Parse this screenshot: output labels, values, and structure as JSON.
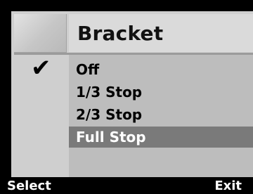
{
  "header": {
    "title": "Bracket"
  },
  "menu": {
    "checked_index": 0,
    "selected_index": 3,
    "items": [
      {
        "label": "Off"
      },
      {
        "label": "1/3 Stop"
      },
      {
        "label": "2/3 Stop"
      },
      {
        "label": "Full Stop"
      }
    ]
  },
  "softkeys": {
    "left": "Select",
    "right": "Exit"
  },
  "icons": {
    "checkmark": "checkmark-icon"
  },
  "colors": {
    "selected_bg": "#7a7a7a",
    "selected_text": "#ffffff"
  }
}
